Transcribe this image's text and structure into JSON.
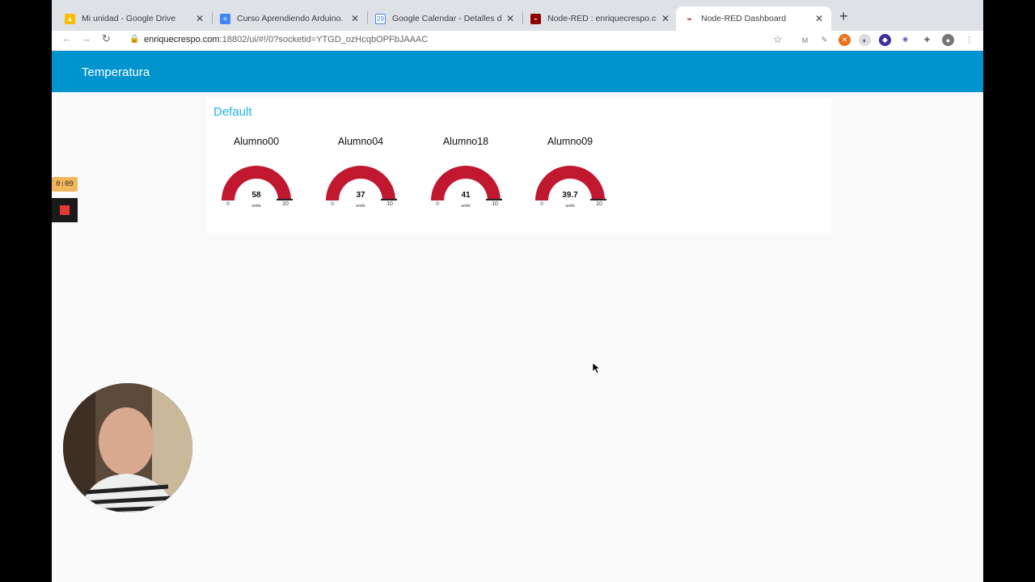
{
  "browser": {
    "tabs": [
      {
        "title": "Mi unidad - Google Drive",
        "icon": "google-drive-icon",
        "color": "#34a853"
      },
      {
        "title": "Curso Aprendiendo Arduino. No",
        "icon": "google-docs-icon",
        "color": "#4285f4"
      },
      {
        "title": "Google Calendar - Detalles del",
        "icon": "google-calendar-icon",
        "color": "#4285f4"
      },
      {
        "title": "Node-RED : enriquecrespo.com",
        "icon": "node-red-icon",
        "color": "#8f0000"
      },
      {
        "title": "Node-RED Dashboard",
        "icon": "node-red-icon",
        "color": "#8f0000"
      }
    ],
    "url_host": "enriquecrespo.com",
    "url_path": ":18802/ui/#!/0?socketid=YTGD_ozHcqbOPFbJAAAC"
  },
  "dashboard": {
    "header_title": "Temperatura",
    "group_title": "Default",
    "accent_color": "#0094ce",
    "gauge_color": "#c0182f",
    "gauges": [
      {
        "label": "Alumno00",
        "value": "58",
        "units": "units",
        "min": "0",
        "max": "10"
      },
      {
        "label": "Alumno04",
        "value": "37",
        "units": "units",
        "min": "0",
        "max": "10"
      },
      {
        "label": "Alumno18",
        "value": "41",
        "units": "units",
        "min": "0",
        "max": "10"
      },
      {
        "label": "Alumno09",
        "value": "39.7",
        "units": "units",
        "min": "0",
        "max": "10"
      }
    ]
  },
  "recorder": {
    "timer": "0:09"
  }
}
